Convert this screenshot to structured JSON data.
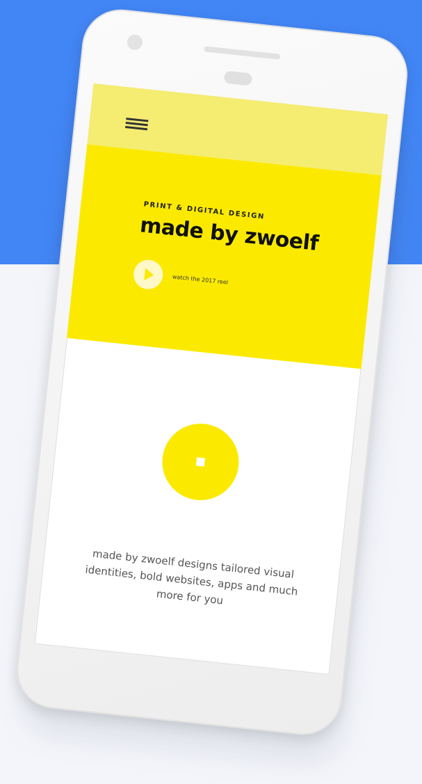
{
  "hero": {
    "subtitle": "PRINT & DIGITAL DESIGN",
    "title": "made by zwoelf",
    "watch_label": "watch the 2017 reel"
  },
  "description": "made by zwoelf designs tailored visual identities, bold websites, apps and much more for you",
  "colors": {
    "background_top": "#4285f4",
    "background_bottom": "#f3f5fa",
    "accent_yellow": "#fbea00",
    "topbar_yellow": "#f5ec72"
  },
  "icons": {
    "menu": "hamburger-menu-icon",
    "play": "play-icon"
  }
}
